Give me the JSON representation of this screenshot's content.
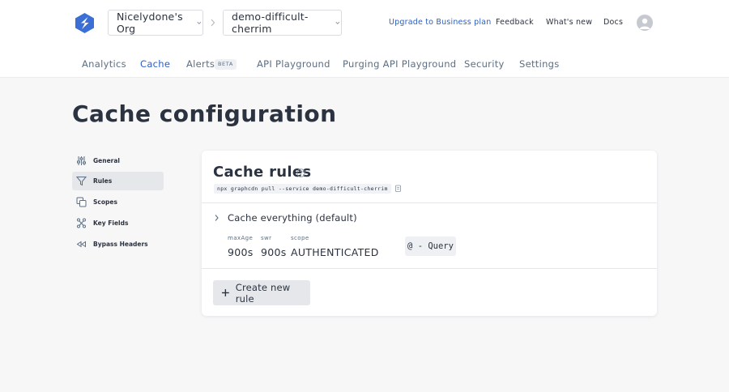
{
  "header": {
    "org_selector": {
      "label": "Nicelydone's Org"
    },
    "project_selector": {
      "label": "demo-difficult-cherrim"
    },
    "links": {
      "upgrade": "Upgrade to Business plan",
      "feedback": "Feedback",
      "whats_new": "What's new",
      "docs": "Docs"
    },
    "icons": [
      "logo-icon",
      "chevron-down-icon",
      "chevron-right-icon",
      "avatar"
    ]
  },
  "tabs": [
    {
      "label": "Analytics",
      "active": false
    },
    {
      "label": "Cache",
      "active": true
    },
    {
      "label": "Alerts",
      "active": false,
      "badge": "BETA"
    },
    {
      "label": "API Playground",
      "active": false
    },
    {
      "label": "Purging API Playground",
      "active": false
    },
    {
      "label": "Security",
      "active": false
    },
    {
      "label": "Settings",
      "active": false
    }
  ],
  "page": {
    "title": "Cache configuration"
  },
  "sidenav": {
    "items": [
      {
        "label": "General",
        "icon": "sliders-icon",
        "active": false
      },
      {
        "label": "Rules",
        "icon": "filter-icon",
        "active": true
      },
      {
        "label": "Scopes",
        "icon": "copy-icon",
        "active": false
      },
      {
        "label": "Key Fields",
        "icon": "tree-icon",
        "active": false
      },
      {
        "label": "Bypass Headers",
        "icon": "rewind-icon",
        "active": false
      }
    ]
  },
  "card": {
    "title": "Cache rules",
    "cli_command": "npx graphcdn pull --service demo-difficult-cherrim",
    "rule": {
      "name": "Cache everything (default)",
      "fields": [
        {
          "label": "maxAge",
          "value": "900s"
        },
        {
          "label": "swr",
          "value": "900s"
        },
        {
          "label": "scope",
          "value": "AUTHENTICATED"
        }
      ],
      "query_chip": "@ - Query"
    },
    "create_button": "Create new rule"
  },
  "colors": {
    "accent": "#2a5fc4",
    "text": "#2b3240",
    "muted": "#5d6f82",
    "background": "#f7f7f8",
    "logo": "#3b6fd6"
  }
}
